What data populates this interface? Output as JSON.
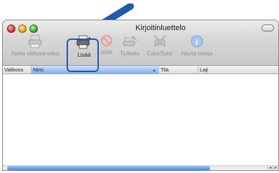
{
  "window": {
    "title": "Kirjoitinluettelo"
  },
  "toolbar": {
    "items": [
      {
        "label": "Aseta oletusarvoksi",
        "icon": "printer-default-icon",
        "active": false
      },
      {
        "label": "Lisää",
        "icon": "add-printer-icon",
        "active": true
      },
      {
        "label": "oista",
        "icon": "delete-icon",
        "active": false
      },
      {
        "label": "Työkalu",
        "icon": "utility-icon",
        "active": false
      },
      {
        "label": "ColorSync",
        "icon": "colorsync-icon",
        "active": false
      },
      {
        "label": "Näytä tietoja",
        "icon": "info-icon",
        "active": false
      }
    ]
  },
  "table": {
    "columns": [
      {
        "label": "Valikoss"
      },
      {
        "label": "Nimi",
        "sorted": true
      },
      {
        "label": "Tila"
      },
      {
        "label": "Laji"
      }
    ],
    "rows": []
  },
  "colors": {
    "accent": "#1d5aa8",
    "arrow": "#1e5cab"
  }
}
